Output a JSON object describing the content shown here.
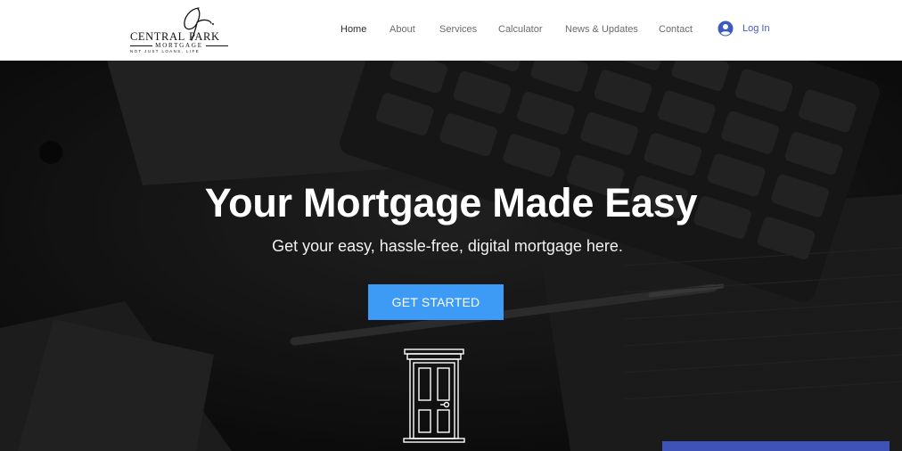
{
  "brand": {
    "name_left": "CENTRAL",
    "name_right": "PARK",
    "subname": "MORTGAGE",
    "tagline": "NOT JUST LOANS, LIFE",
    "accent": "#3d5bbf"
  },
  "nav": {
    "items": [
      {
        "label": "Home",
        "active": true
      },
      {
        "label": "About",
        "active": false
      },
      {
        "label": "Services",
        "active": false
      },
      {
        "label": "Calculator",
        "active": false
      },
      {
        "label": "News & Updates",
        "active": false
      },
      {
        "label": "Contact",
        "active": false
      }
    ],
    "login_label": "Log In",
    "login_icon": "user-avatar-icon"
  },
  "hero": {
    "title": "Your Mortgage Made Easy",
    "subtitle": "Get your easy, hassle-free, digital mortgage here.",
    "cta_label": "GET STARTED",
    "cta_color": "#3d9bf5",
    "door_icon": "door-icon",
    "strip_color": "#3f52b8"
  }
}
